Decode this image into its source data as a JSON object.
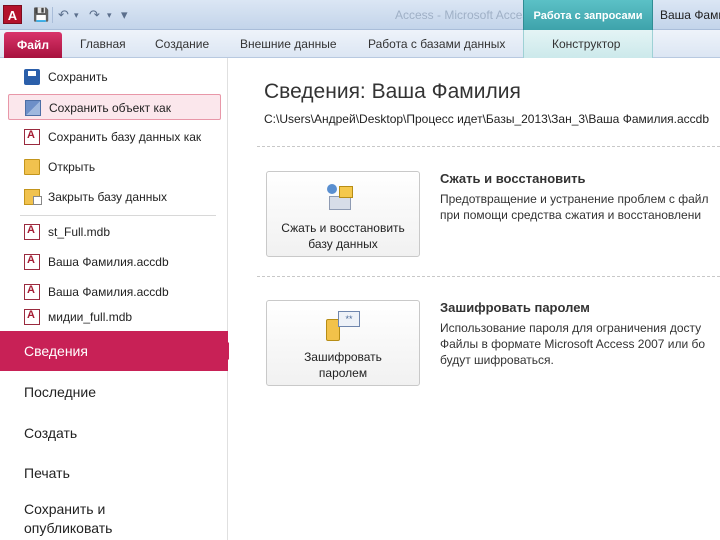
{
  "titlebar": {
    "app_icon": "A",
    "window_title": "Access - Microsoft Access",
    "context_group": "Работа с запросами",
    "title_right": "Ваша Фами"
  },
  "ribbon": {
    "file_tab": "Файл",
    "tabs": [
      "Главная",
      "Создание",
      "Внешние данные",
      "Работа с базами данных"
    ],
    "context_tab": "Конструктор"
  },
  "backstage": {
    "commands": [
      {
        "label": "Сохранить",
        "icon": "save-icon"
      },
      {
        "label": "Сохранить объект как",
        "icon": "save-object-as-icon"
      },
      {
        "label": "Сохранить базу данных как",
        "icon": "database-save-icon"
      },
      {
        "label": "Открыть",
        "icon": "open-folder-icon"
      },
      {
        "label": "Закрыть базу данных",
        "icon": "close-database-icon"
      }
    ],
    "recent_files": [
      "st_Full.mdb",
      "Ваша Фамилия.accdb",
      "Ваша Фамилия.accdb",
      "мидии_full.mdb"
    ],
    "nav": {
      "selected": "Сведения",
      "items": [
        "Последние",
        "Создать",
        "Печать",
        "Сохранить и",
        "опубликовать"
      ]
    }
  },
  "info": {
    "title": "Сведения: Ваша Фамилия",
    "path": "C:\\Users\\Андрей\\Desktop\\Процесс идет\\Базы_2013\\Зан_3\\Ваша Фамилия.accdb",
    "compact": {
      "button_line1": "Сжать и восстановить",
      "button_line2": "базу данных",
      "title": "Сжать и восстановить",
      "desc_line1": "Предотвращение и устранение проблем с файл",
      "desc_line2": "при помощи средства сжатия и восстановлени"
    },
    "encrypt": {
      "button_line1": "Зашифровать",
      "button_line2": "паролем",
      "icon_text": "**",
      "title": "Зашифровать паролем",
      "desc_line1": "Использование пароля для ограничения досту",
      "desc_line2": "Файлы в формате Microsoft Access 2007 или бо",
      "desc_line3": "будут шифроваться."
    }
  },
  "colors": {
    "file_tab": "#b8174a",
    "nav_selected": "#c82156",
    "context_tab": "#4db3b9"
  }
}
